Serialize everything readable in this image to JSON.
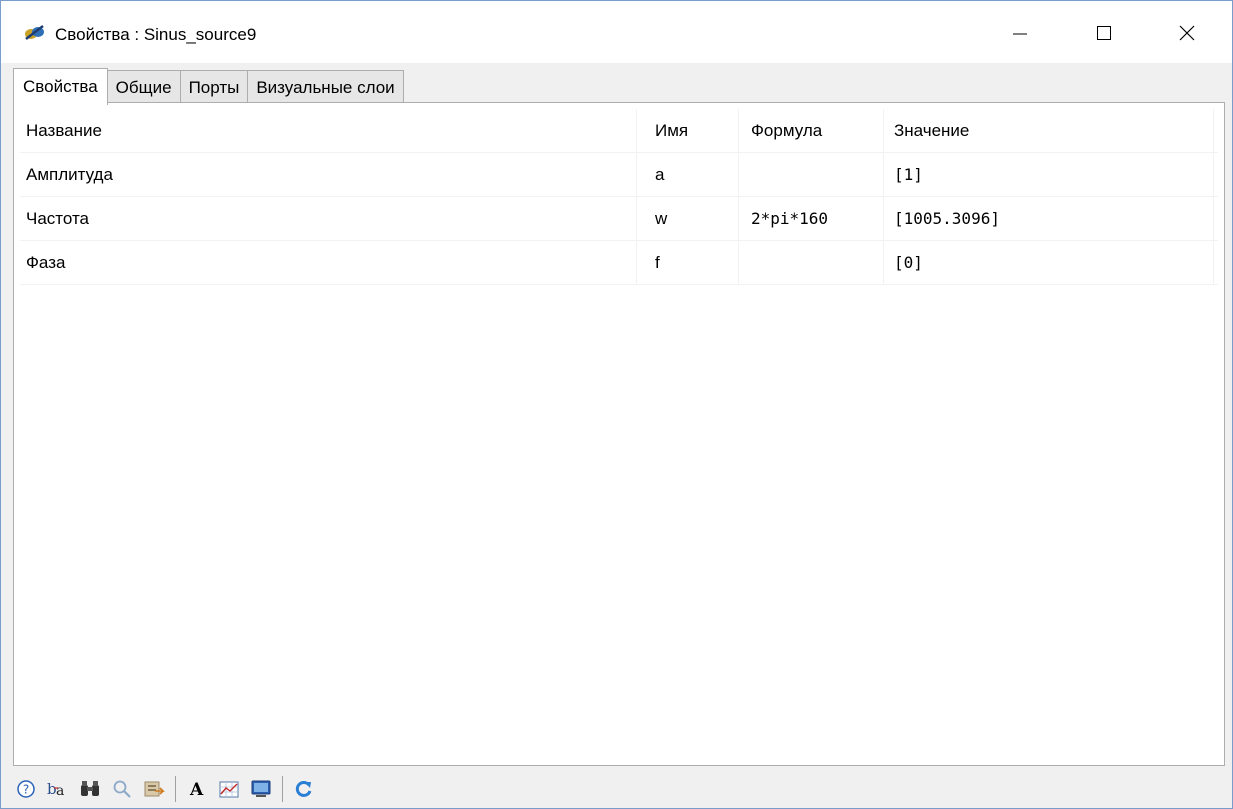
{
  "window": {
    "title": "Свойства : Sinus_source9"
  },
  "tabs": [
    {
      "label": "Свойства",
      "active": true
    },
    {
      "label": "Общие",
      "active": false
    },
    {
      "label": "Порты",
      "active": false
    },
    {
      "label": "Визуальные слои",
      "active": false
    }
  ],
  "table": {
    "headers": [
      "Название",
      "Имя",
      "Формула",
      "Значение"
    ],
    "rows": [
      {
        "title": "Амплитуда",
        "name": "a",
        "formula": "",
        "value": "[1]"
      },
      {
        "title": "Частота",
        "name": "w",
        "formula": "2*pi*160",
        "value": "[1005.3096]"
      },
      {
        "title": "Фаза",
        "name": "f",
        "formula": "",
        "value": "[0]"
      }
    ]
  },
  "toolbar": {
    "icons": [
      "help-icon",
      "rename-icon",
      "binoculars-icon",
      "search-icon",
      "export-icon",
      "font-icon",
      "chart-icon",
      "monitor-icon",
      "refresh-icon"
    ]
  },
  "colors": {
    "window_border": "#7a9ccb",
    "grid_line": "#f2f2f2",
    "tab_border": "#adadad"
  }
}
